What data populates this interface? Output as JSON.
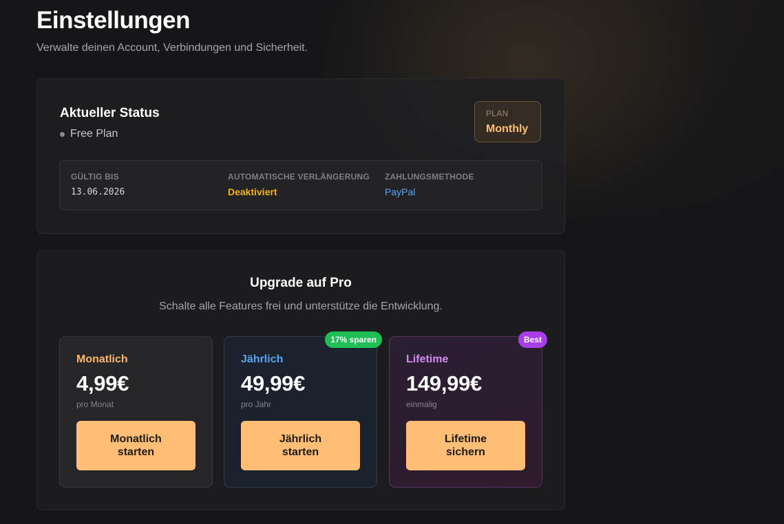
{
  "page": {
    "title": "Einstellungen",
    "subtitle": "Verwalte deinen Account, Verbindungen und Sicherheit."
  },
  "status": {
    "title": "Aktueller Status",
    "plan_name": "Free Plan",
    "badge_label": "PLAN",
    "badge_value": "Monthly",
    "valid_until_label": "GÜLTIG BIS",
    "valid_until_value": "13.06.2026",
    "auto_renew_label": "AUTOMATISCHE VERLÄNGERUNG",
    "auto_renew_value": "Deaktiviert",
    "payment_label": "ZAHLUNGSMETHODE",
    "payment_value": "PayPal"
  },
  "upgrade": {
    "title": "Upgrade auf Pro",
    "subtitle": "Schalte alle Features frei und unterstütze die Entwicklung.",
    "plans": [
      {
        "name": "Monatlich",
        "price": "4,99€",
        "period": "pro Monat",
        "button_label": "Monatlich starten",
        "tag": ""
      },
      {
        "name": "Jährlich",
        "price": "49,99€",
        "period": "pro Jahr",
        "button_label": "Jährlich starten",
        "tag": "17% sparen"
      },
      {
        "name": "Lifetime",
        "price": "149,99€",
        "period": "einmalig",
        "button_label": "Lifetime sichern",
        "tag": "Best"
      }
    ]
  },
  "colors": {
    "background": "#161618",
    "accent_orange": "#ffbe76",
    "accent_blue": "#5aa5f2",
    "accent_purple": "#d38cf5",
    "warning_yellow": "#f4b21b",
    "save_green": "#1fbf55",
    "best_purple": "#a93ee6"
  }
}
